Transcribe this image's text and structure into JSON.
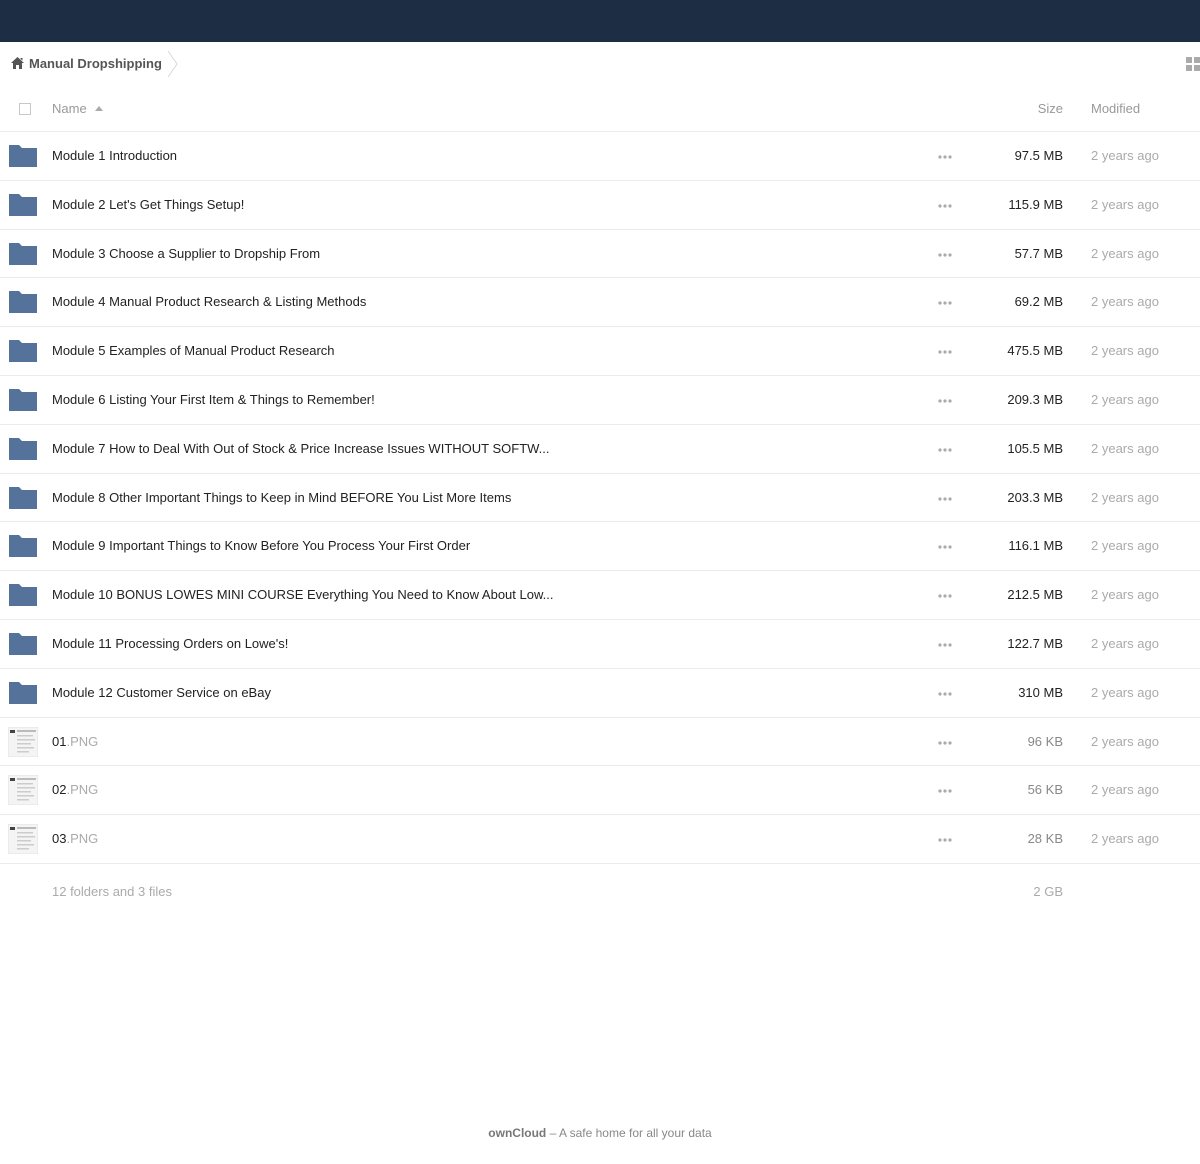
{
  "breadcrumb": {
    "label": "Manual Dropshipping"
  },
  "header": {
    "name": "Name",
    "size": "Size",
    "modified": "Modified"
  },
  "colors": {
    "topbar": "#1d2d44",
    "folder": "#55739a"
  },
  "rows": [
    {
      "name": "Module 1 Introduction",
      "ext": "",
      "size": "97.5 MB",
      "modified": "2 years ago",
      "icon": "folder-icon"
    },
    {
      "name": "Module 2 Let's Get Things Setup!",
      "ext": "",
      "size": "115.9 MB",
      "modified": "2 years ago",
      "icon": "folder-icon"
    },
    {
      "name": "Module 3 Choose a Supplier to Dropship From",
      "ext": "",
      "size": "57.7 MB",
      "modified": "2 years ago",
      "icon": "folder-icon"
    },
    {
      "name": "Module 4 Manual Product Research & Listing Methods",
      "ext": "",
      "size": "69.2 MB",
      "modified": "2 years ago",
      "icon": "folder-icon"
    },
    {
      "name": "Module 5 Examples of Manual Product Research",
      "ext": "",
      "size": "475.5 MB",
      "modified": "2 years ago",
      "icon": "folder-icon"
    },
    {
      "name": "Module 6 Listing Your First Item & Things to Remember!",
      "ext": "",
      "size": "209.3 MB",
      "modified": "2 years ago",
      "icon": "folder-icon"
    },
    {
      "name": "Module 7 How to Deal With Out of Stock & Price Increase Issues WITHOUT SOFTW...",
      "ext": "",
      "size": "105.5 MB",
      "modified": "2 years ago",
      "icon": "folder-icon"
    },
    {
      "name": "Module 8 Other Important Things to Keep in Mind BEFORE You List More Items",
      "ext": "",
      "size": "203.3 MB",
      "modified": "2 years ago",
      "icon": "folder-icon"
    },
    {
      "name": "Module 9 Important Things to Know Before You Process Your First Order",
      "ext": "",
      "size": "116.1 MB",
      "modified": "2 years ago",
      "icon": "folder-icon"
    },
    {
      "name": "Module 10 BONUS LOWES MINI COURSE Everything You Need to Know About Low...",
      "ext": "",
      "size": "212.5 MB",
      "modified": "2 years ago",
      "icon": "folder-icon"
    },
    {
      "name": "Module 11 Processing Orders on Lowe's!",
      "ext": "",
      "size": "122.7 MB",
      "modified": "2 years ago",
      "icon": "folder-icon"
    },
    {
      "name": "Module 12 Customer Service on eBay",
      "ext": "",
      "size": "310 MB",
      "modified": "2 years ago",
      "icon": "folder-icon"
    },
    {
      "name": "01",
      "ext": ".PNG",
      "size": "96 KB",
      "modified": "2 years ago",
      "icon": "image-thumbnail-icon"
    },
    {
      "name": "02",
      "ext": ".PNG",
      "size": "56 KB",
      "modified": "2 years ago",
      "icon": "image-thumbnail-icon"
    },
    {
      "name": "03",
      "ext": ".PNG",
      "size": "28 KB",
      "modified": "2 years ago",
      "icon": "image-thumbnail-icon"
    }
  ],
  "summary": {
    "count": "12 folders and 3 files",
    "size": "2 GB"
  },
  "footer": {
    "brand": "ownCloud",
    "tagline": " – A safe home for all your data"
  }
}
